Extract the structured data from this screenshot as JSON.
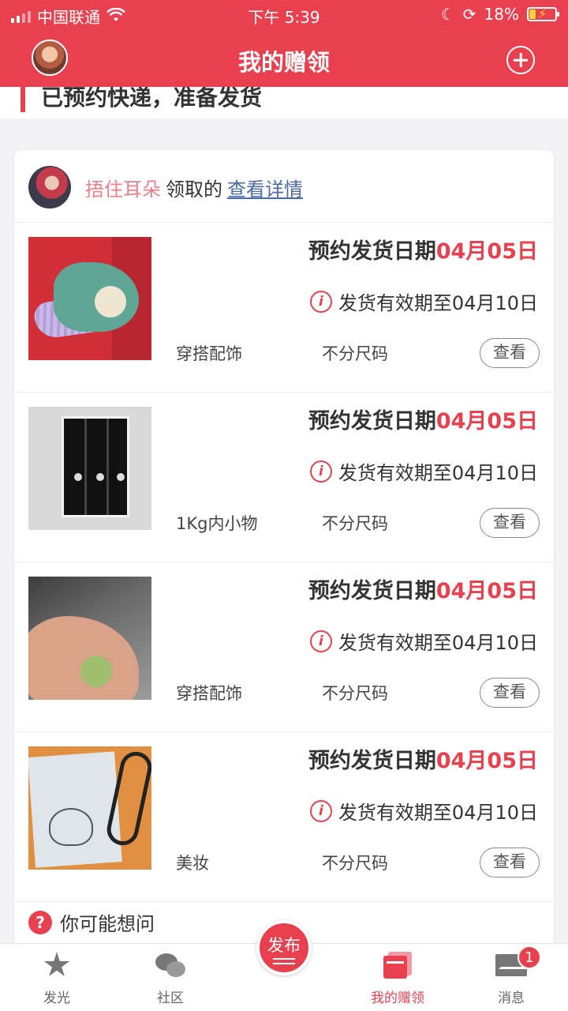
{
  "status": {
    "carrier": "中国联通",
    "time": "下午 5:39",
    "battery": "18%"
  },
  "header": {
    "title": "我的赠领"
  },
  "section": {
    "heading": "已预约快递，准备发货"
  },
  "claim": {
    "user": "捂住耳朵",
    "action": "领取的",
    "detail_link": "查看详情"
  },
  "items": [
    {
      "date_prefix": "预约发货日期",
      "date": "04月05日",
      "valid": "发货有效期至04月10日",
      "category": "穿搭配饰",
      "size": "不分尺码",
      "view": "查看"
    },
    {
      "date_prefix": "预约发货日期",
      "date": "04月05日",
      "valid": "发货有效期至04月10日",
      "category": "1Kg内小物",
      "size": "不分尺码",
      "view": "查看"
    },
    {
      "date_prefix": "预约发货日期",
      "date": "04月05日",
      "valid": "发货有效期至04月10日",
      "category": "穿搭配饰",
      "size": "不分尺码",
      "view": "查看"
    },
    {
      "date_prefix": "预约发货日期",
      "date": "04月05日",
      "valid": "发货有效期至04月10日",
      "category": "美妆",
      "size": "不分尺码",
      "view": "查看"
    }
  ],
  "faq": {
    "label": "你可能想问"
  },
  "tabbar": {
    "tabs": [
      {
        "label": "发光",
        "icon": "star-icon"
      },
      {
        "label": "社区",
        "icon": "chat-bubbles-icon"
      },
      {
        "label": "发布",
        "icon": "publish-icon"
      },
      {
        "label": "我的赠领",
        "icon": "gift-box-icon",
        "active": true
      },
      {
        "label": "消息",
        "icon": "mail-icon",
        "badge": "1"
      }
    ]
  },
  "colors": {
    "brand": "#e8404f",
    "link": "#4a6aa8",
    "username": "#ee7e8a"
  }
}
